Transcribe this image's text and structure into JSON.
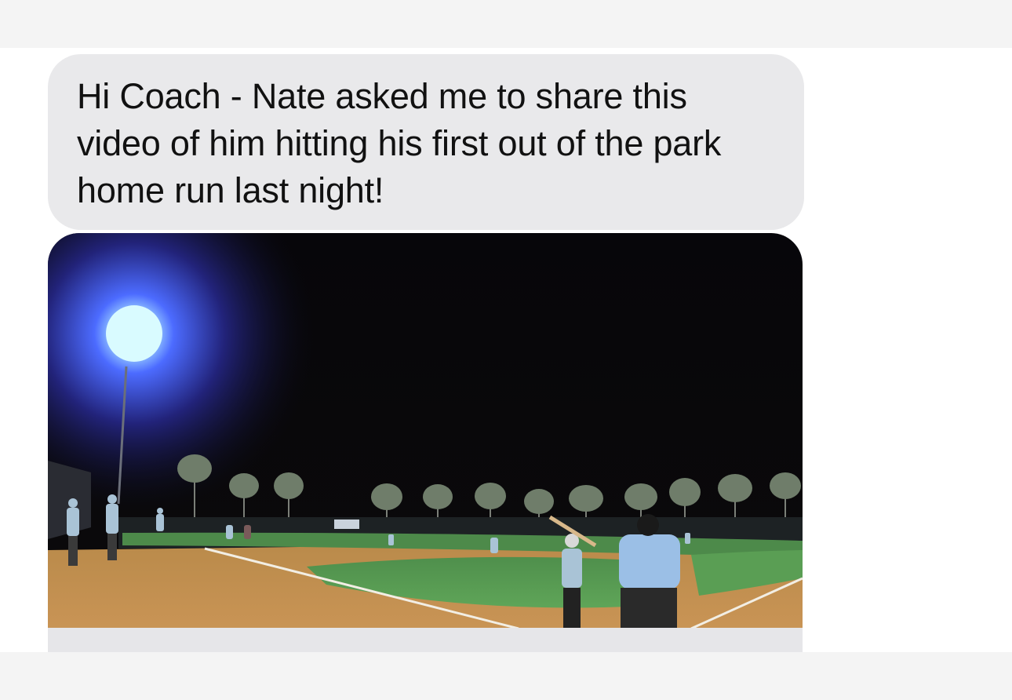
{
  "conversation": {
    "messages": [
      {
        "direction": "incoming",
        "type": "text",
        "text": "Hi Coach - Nate asked me to share this video of him hitting his first out of the park home run last night!"
      },
      {
        "direction": "incoming",
        "type": "video",
        "scene": "night-baseball-game-video-thumbnail"
      }
    ]
  },
  "colors": {
    "bubble_incoming": "#e9e9eb",
    "chrome_background": "#f4f4f4",
    "text": "#111111"
  }
}
